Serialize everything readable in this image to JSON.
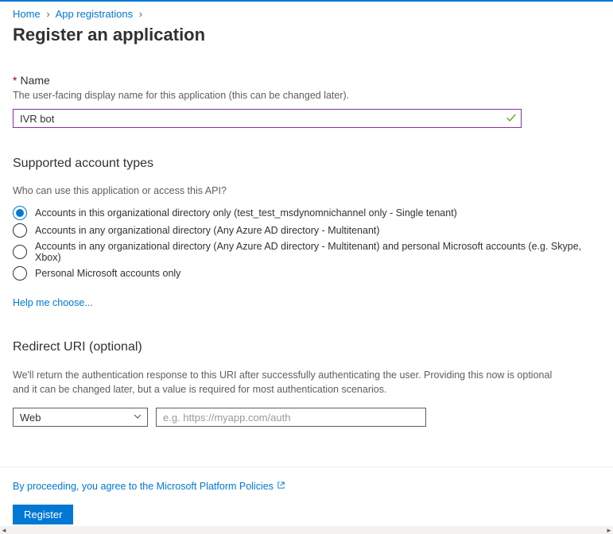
{
  "breadcrumb": {
    "home": "Home",
    "appreg": "App registrations"
  },
  "title": "Register an application",
  "name": {
    "label": "Name",
    "hint": "The user-facing display name for this application (this can be changed later).",
    "value": "IVR bot"
  },
  "accountTypes": {
    "heading": "Supported account types",
    "question": "Who can use this application or access this API?",
    "options": {
      "opt0": "Accounts in this organizational directory only (test_test_msdynomnichannel only - Single tenant)",
      "opt1": "Accounts in any organizational directory (Any Azure AD directory - Multitenant)",
      "opt2": "Accounts in any organizational directory (Any Azure AD directory - Multitenant) and personal Microsoft accounts (e.g. Skype, Xbox)",
      "opt3": "Personal Microsoft accounts only"
    },
    "helpLink": "Help me choose..."
  },
  "redirect": {
    "heading": "Redirect URI (optional)",
    "desc": "We'll return the authentication response to this URI after successfully authenticating the user. Providing this now is optional and it can be changed later, but a value is required for most authentication scenarios.",
    "platform": "Web",
    "placeholder": "e.g. https://myapp.com/auth"
  },
  "footer": {
    "policy": "By proceeding, you agree to the Microsoft Platform Policies",
    "register": "Register"
  }
}
